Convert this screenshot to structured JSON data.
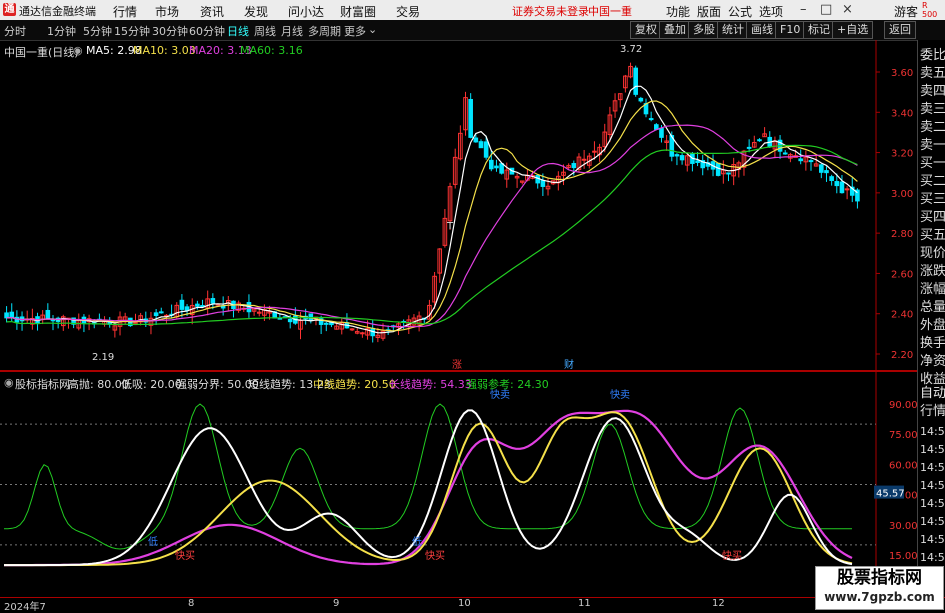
{
  "titlebar": {
    "app_name": "通达信金融终端",
    "menu": [
      "行情",
      "市场",
      "资讯",
      "发现",
      "问小达",
      "财富圈",
      "交易"
    ],
    "warning": "证券交易未登录",
    "stock_name": "中国一重",
    "right_menu": [
      "功能",
      "版面",
      "公式",
      "选项"
    ],
    "guest": "游客"
  },
  "toolbar": {
    "periods": [
      "分时",
      "1分钟",
      "5分钟",
      "15分钟",
      "30分钟",
      "60分钟",
      "日线",
      "周线",
      "月线",
      "多周期",
      "更多"
    ],
    "active_period": "日线",
    "buttons": [
      "复权",
      "叠加",
      "多股",
      "统计",
      "画线",
      "F10",
      "标记",
      "+自选",
      "返回"
    ]
  },
  "main_chart": {
    "title": "中国一重(日线)",
    "ma": [
      {
        "name": "MA5",
        "value": "2.98",
        "color": "#ffffff"
      },
      {
        "name": "MA10",
        "value": "3.03",
        "color": "#f4e04a"
      },
      {
        "name": "MA20",
        "value": "3.13",
        "color": "#e040e0"
      },
      {
        "name": "MA60",
        "value": "3.16",
        "color": "#22cc22"
      }
    ],
    "y_ticks": [
      "3.60",
      "3.40",
      "3.20",
      "3.00",
      "2.80",
      "2.60",
      "2.40",
      "2.20"
    ],
    "high_label": "3.72",
    "low_label": "2.19",
    "events": [
      "涨",
      "财"
    ],
    "t_marker": "T"
  },
  "sub_chart": {
    "name": "股标指标网",
    "params": [
      {
        "text": "高抛: 80.00",
        "color": "#dddddd"
      },
      {
        "text": "低吸: 20.00",
        "color": "#dddddd"
      },
      {
        "text": "强弱分界: 50.00",
        "color": "#dddddd"
      },
      {
        "text": "短线趋势: 13.23",
        "color": "#dddddd"
      },
      {
        "text": "中线趋势: 20.50",
        "color": "#f4e04a"
      },
      {
        "text": "长线趋势: 54.33",
        "color": "#e040e0"
      },
      {
        "text": "强弱参考: 24.30",
        "color": "#22cc22"
      }
    ],
    "y_ticks": [
      "90.00",
      "75.00",
      "60.00",
      "45.00",
      "30.00",
      "15.00"
    ],
    "current_value": "45.57",
    "signals_buy": [
      "快买",
      "快买",
      "快买"
    ],
    "signals_sell": [
      "快卖",
      "快卖"
    ],
    "signal_low": [
      "低",
      "低"
    ]
  },
  "right_panel": {
    "items": [
      "委比",
      "卖五",
      "卖四",
      "卖三",
      "卖二",
      "卖一",
      "买一",
      "买二",
      "买三",
      "买四",
      "买五",
      "现价",
      "涨跌",
      "涨幅",
      "总量",
      "外盘",
      "换手",
      "净资",
      "收益"
    ],
    "tabs": [
      "自动",
      "行情"
    ],
    "times": [
      "14:56",
      "14:56",
      "14:56",
      "14:56",
      "14:56",
      "14:56",
      "14:56",
      "14:56",
      "14:56",
      "14:56"
    ]
  },
  "date_axis": [
    "2024年7",
    "8",
    "9",
    "10",
    "11",
    "12"
  ],
  "watermark": {
    "line1": "股票指标网",
    "line2": "www.7gpzb.com"
  },
  "colors": {
    "up": "#ff3333",
    "down": "#00e5ff",
    "ma5": "#ffffff",
    "ma10": "#f4e04a",
    "ma20": "#e040e0",
    "ma60": "#22cc22"
  }
}
